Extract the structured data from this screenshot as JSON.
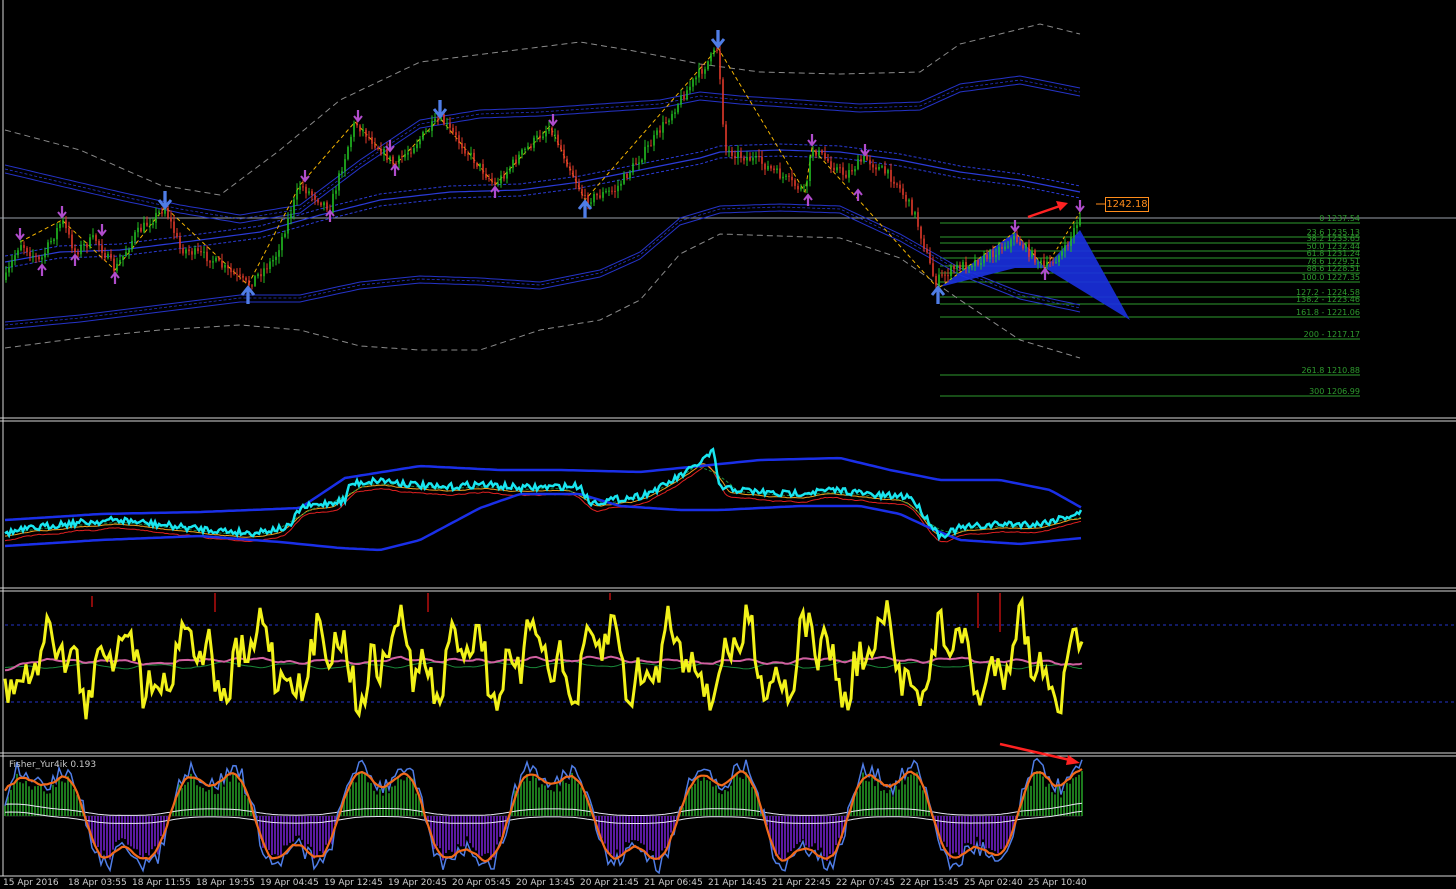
{
  "current_price_label": "1242.18",
  "fibonacci_levels": [
    {
      "label": "0 1237.54"
    },
    {
      "label": "23.6 1235.13"
    },
    {
      "label": "38.2 1233.65"
    },
    {
      "label": "50.0 1232.44"
    },
    {
      "label": "61.8 1231.24"
    },
    {
      "label": "78.6 1229.51"
    },
    {
      "label": "88.6 1228.51"
    },
    {
      "label": "100.0 1227.35"
    },
    {
      "label": "127.2 - 1224.58"
    },
    {
      "label": "138.2 - 1223.46"
    },
    {
      "label": "161.8 - 1221.06"
    },
    {
      "label": "200 - 1217.17"
    },
    {
      "label": "261.8 1210.88"
    },
    {
      "label": "300 1206.99"
    }
  ],
  "indicator_label": "Fisher_Yur4ik 0.193",
  "time_axis": [
    "15 Apr 2016",
    "18 Apr 03:55",
    "18 Apr 11:55",
    "18 Apr 19:55",
    "19 Apr 04:45",
    "19 Apr 12:45",
    "19 Apr 20:45",
    "20 Apr 05:45",
    "20 Apr 13:45",
    "20 Apr 21:45",
    "21 Apr 06:45",
    "21 Apr 14:45",
    "21 Apr 22:45",
    "22 Apr 07:45",
    "22 Apr 15:45",
    "25 Apr 02:40",
    "25 Apr 10:40"
  ],
  "colors": {
    "background": "#000000",
    "bull_candle": "#22c022",
    "bear_candle": "#e23a2a",
    "band_blue": "#1a2fd0",
    "cyan_line": "#19e6f0",
    "yellow_line": "#f2f21a",
    "fib_green": "#2e9a2e",
    "arrow_purple": "#b04ccc",
    "arrow_blue": "#4f7de6",
    "zigzag": "#f4b400",
    "annotation_red": "#ff2222",
    "histogram_green": "#1d7a1d",
    "histogram_purple": "#5a1aa0",
    "fisher_orange": "#f26a1b",
    "fisher_blue": "#4f7de6",
    "price_tag": "#ff8c1a"
  },
  "panels": [
    "main-price-panel",
    "bands-indicator-panel",
    "oscillator-panel",
    "fisher-panel"
  ]
}
